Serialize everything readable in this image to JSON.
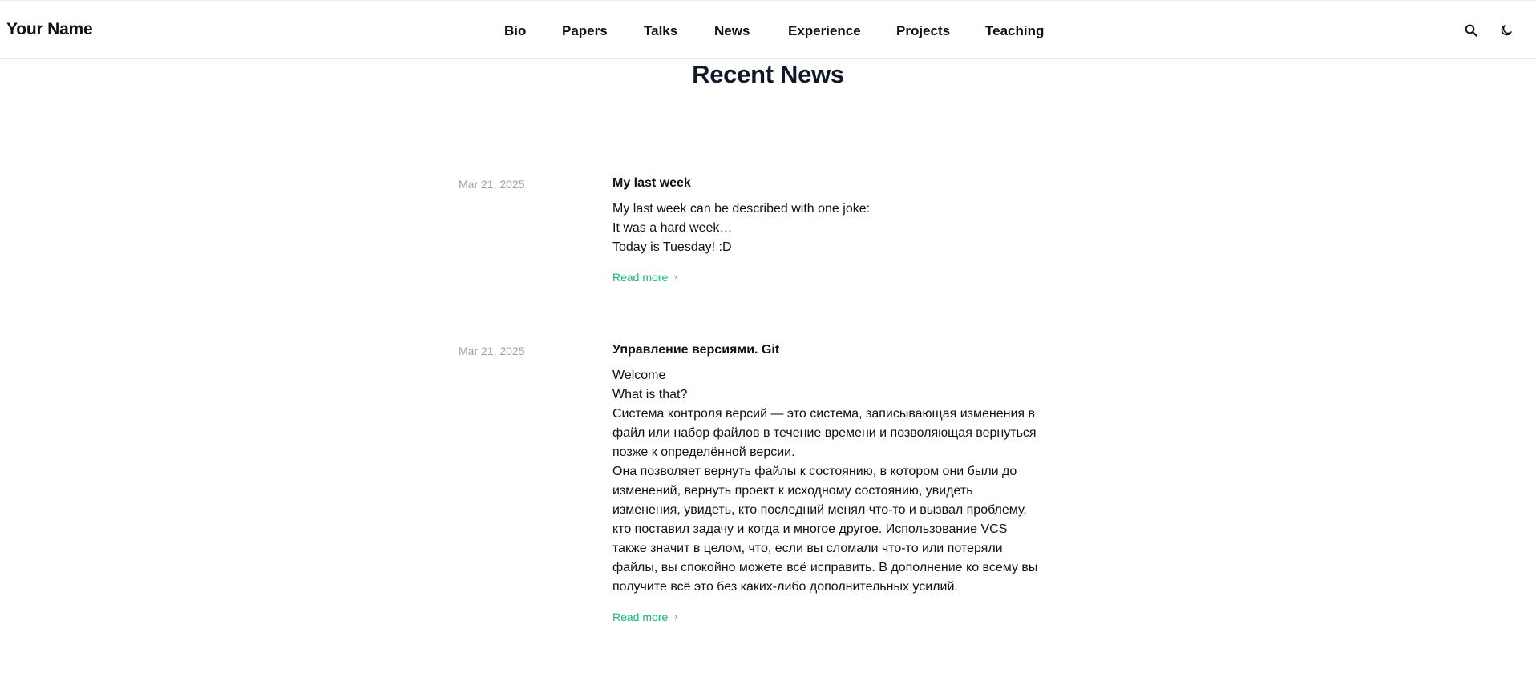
{
  "header": {
    "brand": "Your Name",
    "nav": [
      {
        "label": "Bio"
      },
      {
        "label": "Papers"
      },
      {
        "label": "Talks"
      },
      {
        "label": "News"
      },
      {
        "label": "Experience"
      },
      {
        "label": "Projects"
      },
      {
        "label": "Teaching"
      }
    ],
    "icons": {
      "search": "search-icon",
      "theme": "moon-icon"
    }
  },
  "page": {
    "title": "Recent News"
  },
  "posts": [
    {
      "date": "Mar 21, 2025",
      "title": "My last week",
      "lines": [
        "My last week can be described with one joke:",
        "It was a hard week…",
        "Today is Tuesday! :D"
      ],
      "read_more": "Read more"
    },
    {
      "date": "Mar 21, 2025",
      "title": "Управление версиями. Git",
      "lines": [
        "Welcome",
        "What is that?",
        "Система контроля версий — это система, записывающая изменения в",
        "файл или набор файлов в течение времени и позволяющая вернуться",
        "позже к определённой версии.",
        "Она позволяет вернуть файлы к состоянию, в котором они были до",
        "изменений, вернуть проект к исходному состоянию, увидеть",
        "изменения, увидеть, кто последний менял что-то и вызвал проблему,",
        "кто поставил задачу и когда и многое другое. Использование VCS",
        "также значит в целом, что, если вы сломали что-то или потеряли",
        "файлы, вы спокойно можете всё исправить. В дополнение ко всему вы",
        "получите всё это без каких-либо дополнительных усилий."
      ],
      "read_more": "Read more"
    }
  ],
  "colors": {
    "accent": "#10b981",
    "muted": "#9ca3af",
    "text": "#111827"
  }
}
